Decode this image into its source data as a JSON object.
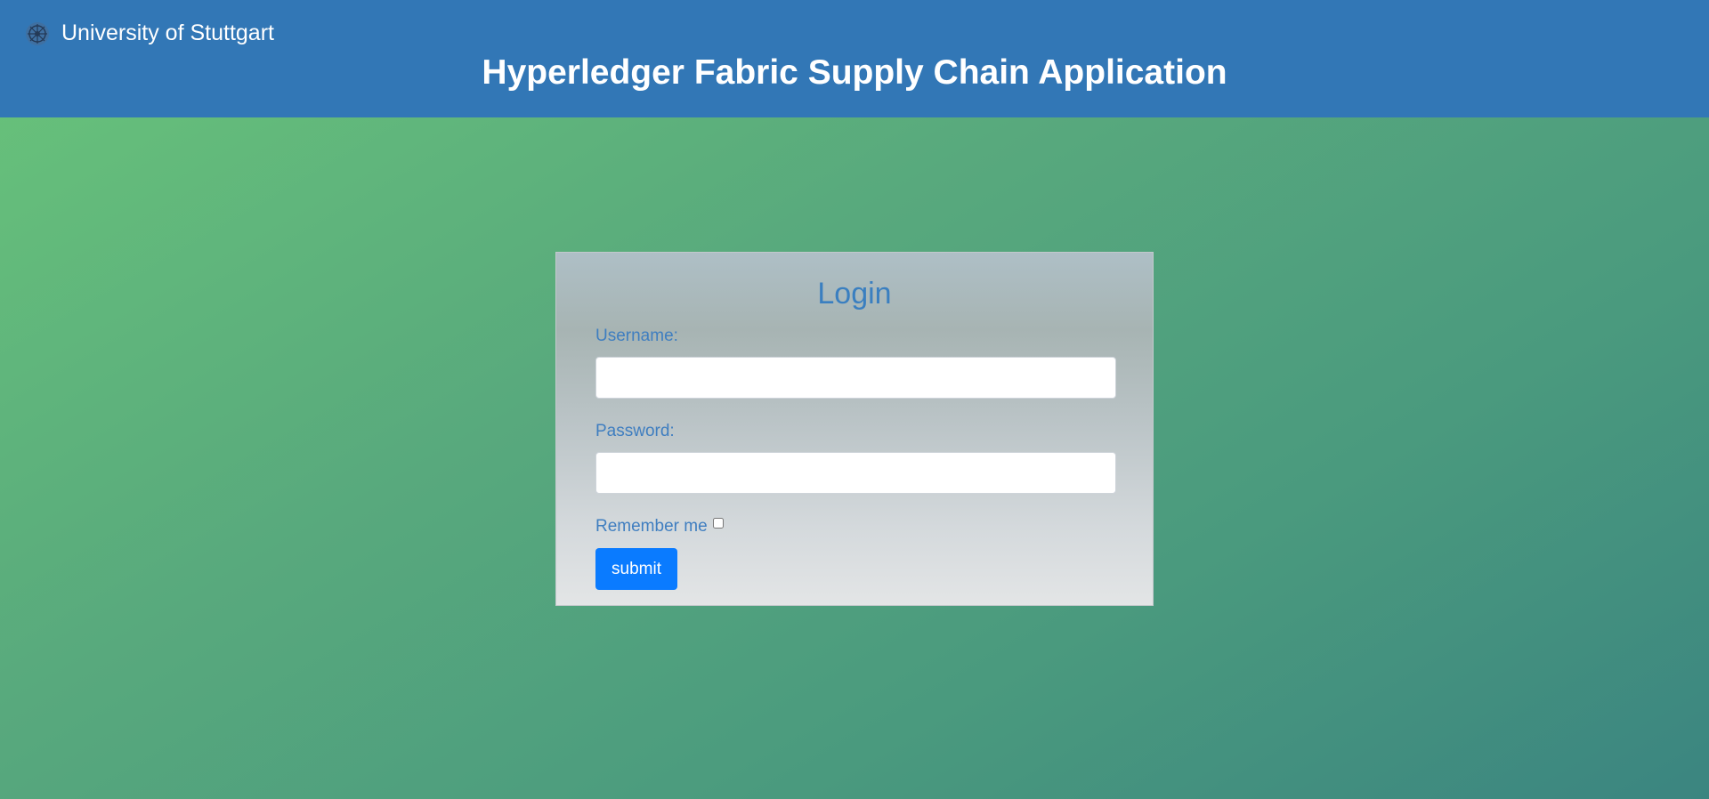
{
  "header": {
    "brand_label": "University of Stuttgart",
    "brand_icon": "university-seal-icon",
    "app_title": "Hyperledger Fabric Supply Chain Application",
    "color": "#3277b6"
  },
  "login": {
    "title": "Login",
    "username_label": "Username:",
    "username_value": "",
    "username_placeholder": "",
    "password_label": "Password:",
    "password_value": "",
    "password_placeholder": "",
    "remember_label": "Remember me",
    "remember_checked": false,
    "submit_label": "submit",
    "accent_color": "#0a7bff",
    "label_color": "#3f7ec0"
  }
}
